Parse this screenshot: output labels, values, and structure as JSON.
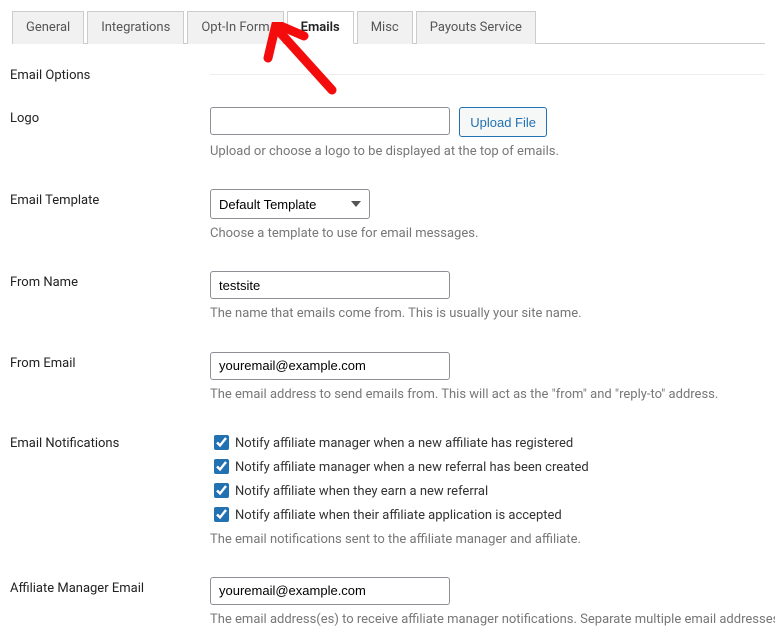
{
  "tabs": {
    "general": "General",
    "integrations": "Integrations",
    "optin": "Opt-In Form",
    "emails": "Emails",
    "misc": "Misc",
    "payouts": "Payouts Service"
  },
  "section": {
    "email_options": "Email Options"
  },
  "logo": {
    "label": "Logo",
    "value": "",
    "upload_btn": "Upload File",
    "hint": "Upload or choose a logo to be displayed at the top of emails."
  },
  "template": {
    "label": "Email Template",
    "value": "Default Template",
    "hint": "Choose a template to use for email messages."
  },
  "from_name": {
    "label": "From Name",
    "value": "testsite",
    "hint": "The name that emails come from. This is usually your site name."
  },
  "from_email": {
    "label": "From Email",
    "value": "youremail@example.com",
    "hint": "The email address to send emails from. This will act as the \"from\" and \"reply-to\" address."
  },
  "notifications": {
    "label": "Email Notifications",
    "opt1": "Notify affiliate manager when a new affiliate has registered",
    "opt2": "Notify affiliate manager when a new referral has been created",
    "opt3": "Notify affiliate when they earn a new referral",
    "opt4": "Notify affiliate when their affiliate application is accepted",
    "hint": "The email notifications sent to the affiliate manager and affiliate."
  },
  "manager_email": {
    "label": "Affiliate Manager Email",
    "value": "youremail@example.com",
    "hint": "The email address(es) to receive affiliate manager notifications. Separate multiple email addresses with a comma (,). The adr"
  }
}
